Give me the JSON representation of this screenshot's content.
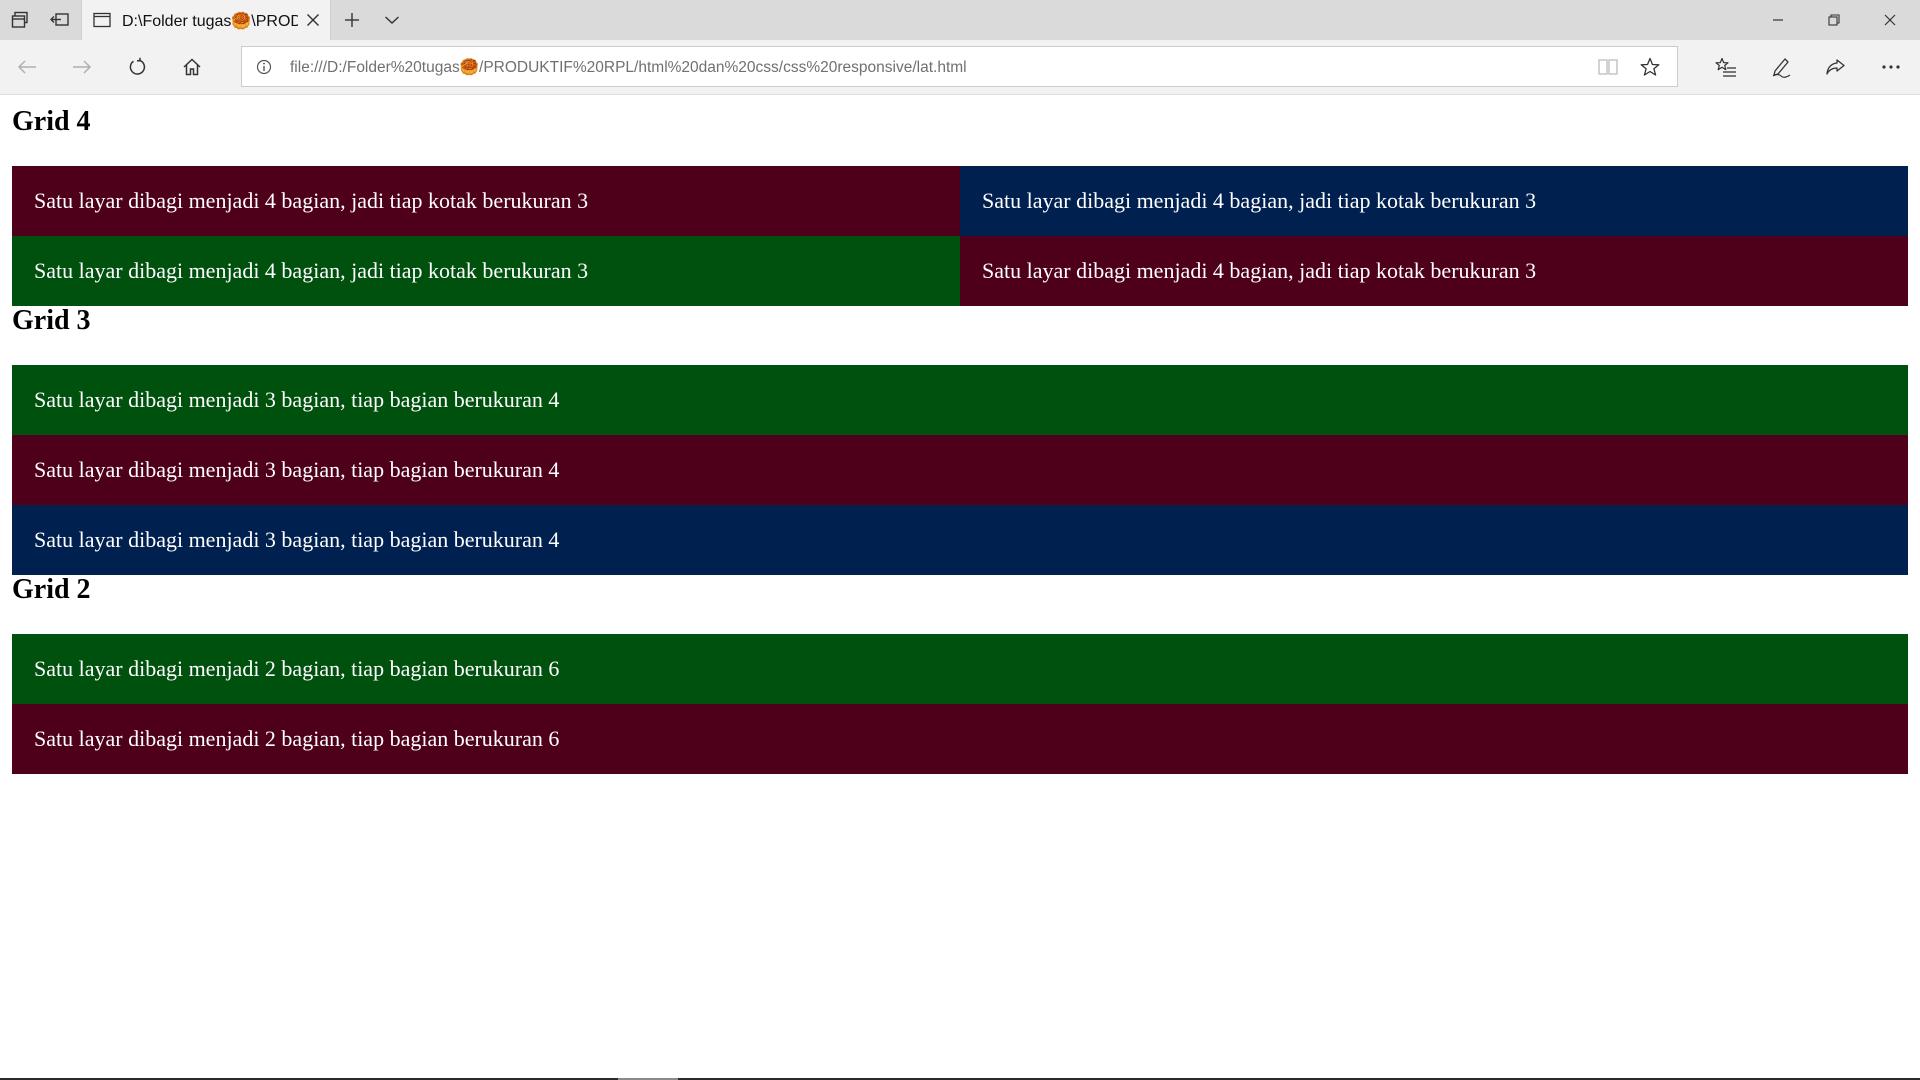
{
  "browser": {
    "tab": {
      "title": "D:\\Folder tugas🥮\\PRODUKTIF RPL\\html dan css\\css responsive\\lat.html"
    },
    "address": {
      "url": "file:///D:/Folder%20tugas🥮/PRODUKTIF%20RPL/html%20dan%20css/css%20responsive/lat.html"
    },
    "icons": {
      "tab_actions": "tab-actions-icon",
      "set_aside": "set-aside-tabs-icon",
      "page": "page-icon",
      "close_tab": "close-icon",
      "new_tab": "plus-icon",
      "tab_menu": "chevron-down-icon",
      "minimize": "minimize-icon",
      "restore": "restore-icon",
      "close_window": "close-icon",
      "back": "back-arrow-icon",
      "forward": "forward-arrow-icon",
      "refresh": "refresh-icon",
      "home": "home-icon",
      "info": "info-icon",
      "reading_view": "reading-view-icon",
      "favorite": "star-icon",
      "favorites_hub": "favorites-list-icon",
      "web_note": "pen-icon",
      "share": "share-icon",
      "more": "more-icon"
    }
  },
  "page": {
    "sections": [
      {
        "heading": "Grid 4",
        "rows": [
          {
            "cells": [
              {
                "text": "Satu layar dibagi menjadi 4 bagian, jadi tiap kotak berukuran 3",
                "color": "#4e001a"
              },
              {
                "text": "Satu layar dibagi menjadi 4 bagian, jadi tiap kotak berukuran 3",
                "color": "#00204f"
              }
            ]
          },
          {
            "cells": [
              {
                "text": "Satu layar dibagi menjadi 4 bagian, jadi tiap kotak berukuran 3",
                "color": "#00510d"
              },
              {
                "text": "Satu layar dibagi menjadi 4 bagian, jadi tiap kotak berukuran 3",
                "color": "#4e001a"
              }
            ]
          }
        ]
      },
      {
        "heading": "Grid 3",
        "rows": [
          {
            "cells": [
              {
                "text": "Satu layar dibagi menjadi 3 bagian, tiap bagian berukuran 4",
                "color": "#00510d"
              }
            ]
          },
          {
            "cells": [
              {
                "text": "Satu layar dibagi menjadi 3 bagian, tiap bagian berukuran 4",
                "color": "#4e001a"
              }
            ]
          },
          {
            "cells": [
              {
                "text": "Satu layar dibagi menjadi 3 bagian, tiap bagian berukuran 4",
                "color": "#00204f"
              }
            ]
          }
        ]
      },
      {
        "heading": "Grid 2",
        "rows": [
          {
            "cells": [
              {
                "text": "Satu layar dibagi menjadi 2 bagian, tiap bagian berukuran 6",
                "color": "#00510d"
              }
            ]
          },
          {
            "cells": [
              {
                "text": "Satu layar dibagi menjadi 2 bagian, tiap bagian berukuran 6",
                "color": "#4e001a"
              }
            ]
          }
        ]
      }
    ]
  }
}
